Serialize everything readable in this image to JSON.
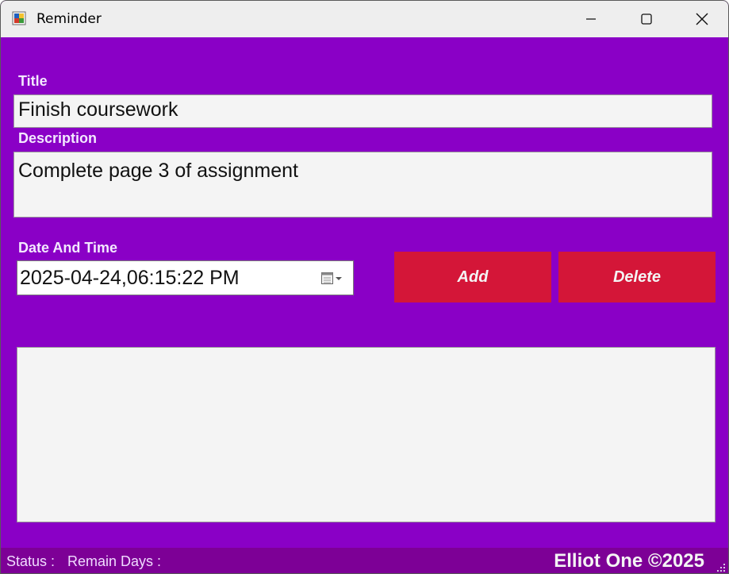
{
  "window": {
    "title": "Reminder",
    "icons": {
      "app": "reminder-app-icon",
      "minimize": "minimize-icon",
      "maximize": "maximize-icon",
      "close": "close-icon"
    }
  },
  "form": {
    "title_label": "Title",
    "title_value": "Finish coursework",
    "description_label": "Description",
    "description_value": "Complete page 3 of assignment",
    "datetime_label": "Date And Time",
    "datetime_value": "2025-04-24,06:15:22 PM",
    "calendar_icon": "calendar-dropdown-icon"
  },
  "buttons": {
    "add": "Add",
    "delete": "Delete"
  },
  "list": {
    "items": []
  },
  "status": {
    "status_label": "Status :",
    "remain_label": "Remain Days :",
    "copyright": "Elliot One ©2025"
  },
  "colors": {
    "background": "#8a00c6",
    "button": "#d41638",
    "statusbar": "#7d0096",
    "field": "#f4f4f4"
  }
}
